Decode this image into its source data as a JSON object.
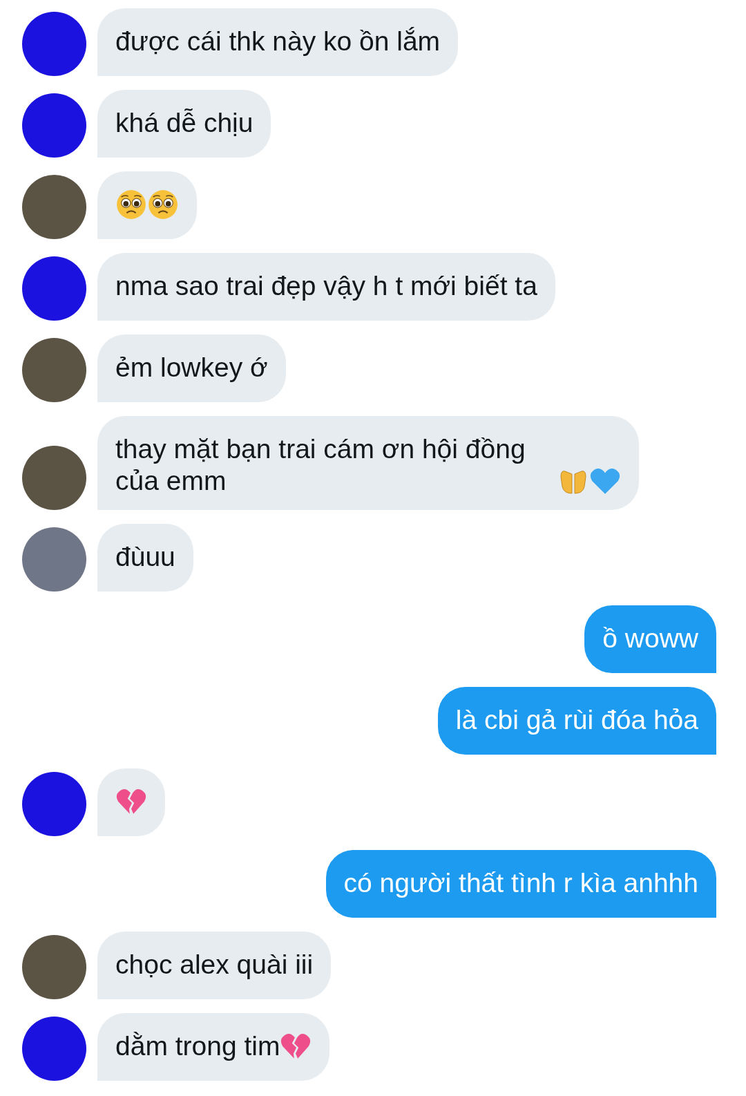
{
  "messages": [
    {
      "outgoing": false,
      "color": "#1c12e0",
      "parts": [
        {
          "kind": "text",
          "text": "được cái thk này ko ồn lắm"
        }
      ]
    },
    {
      "outgoing": false,
      "color": "#1c12e0",
      "parts": [
        {
          "kind": "text",
          "text": "khá dễ chịu"
        }
      ]
    },
    {
      "outgoing": false,
      "color": "#5b5444",
      "parts": [
        {
          "kind": "pleading-face"
        },
        {
          "kind": "pleading-face"
        }
      ]
    },
    {
      "outgoing": false,
      "color": "#1c12e0",
      "parts": [
        {
          "kind": "text",
          "text": "nma sao trai đẹp vậy h t mới biết ta"
        }
      ]
    },
    {
      "outgoing": false,
      "color": "#5b5444",
      "parts": [
        {
          "kind": "text",
          "text": "ẻm lowkey ớ"
        }
      ]
    },
    {
      "outgoing": false,
      "color": "#5b5444",
      "parts": [
        {
          "kind": "text",
          "text": "thay mặt bạn trai cám ơn hội đồng của emm"
        },
        {
          "kind": "open-hands"
        },
        {
          "kind": "blue-heart"
        }
      ]
    },
    {
      "outgoing": false,
      "color": "#6f7687",
      "parts": [
        {
          "kind": "text",
          "text": "đùuu"
        }
      ]
    },
    {
      "outgoing": true,
      "parts": [
        {
          "kind": "text",
          "text": "ồ woww"
        }
      ]
    },
    {
      "outgoing": true,
      "parts": [
        {
          "kind": "text",
          "text": "là cbi gả rùi đóa hỏa"
        }
      ]
    },
    {
      "outgoing": false,
      "color": "#1c12e0",
      "parts": [
        {
          "kind": "broken-heart"
        }
      ]
    },
    {
      "outgoing": true,
      "parts": [
        {
          "kind": "text",
          "text": "có người thất tình r kìa anhhh"
        }
      ]
    },
    {
      "outgoing": false,
      "color": "#5b5444",
      "parts": [
        {
          "kind": "text",
          "text": "chọc alex quài iii"
        }
      ]
    },
    {
      "outgoing": false,
      "color": "#1c12e0",
      "parts": [
        {
          "kind": "text",
          "text": "dằm trong tim"
        },
        {
          "kind": "broken-heart"
        }
      ]
    }
  ]
}
